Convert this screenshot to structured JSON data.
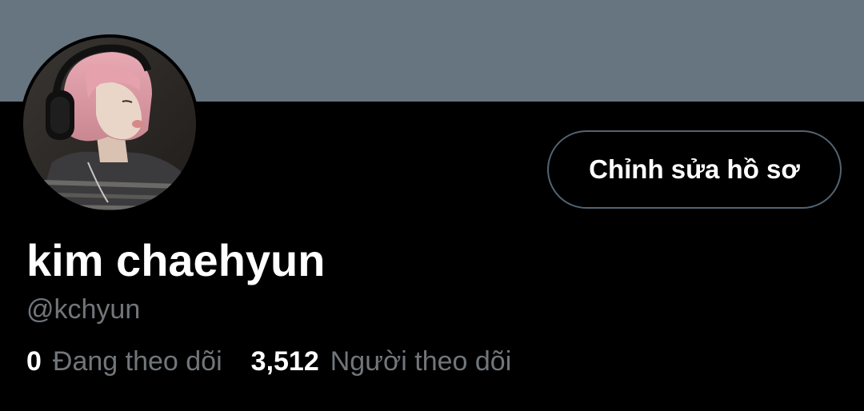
{
  "profile": {
    "avatar_alt": "profile photo",
    "display_name": "kim chaehyun",
    "handle": "@kchyun",
    "edit_button_label": "Chỉnh sửa hồ sơ",
    "following": {
      "count": "0",
      "label": "Đang theo dõi"
    },
    "followers": {
      "count": "3,512",
      "label": "Người theo dõi"
    }
  },
  "colors": {
    "banner": "#66757f",
    "background": "#000000",
    "primary_text": "#ffffff",
    "secondary_text": "#71767b",
    "button_border": "#536471"
  }
}
